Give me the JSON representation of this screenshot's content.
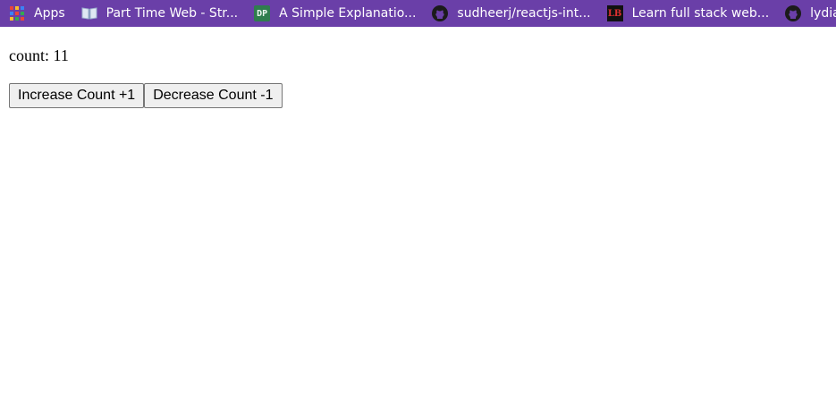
{
  "bookmarks": [
    {
      "label": "Apps",
      "icon": "apps-grid-icon"
    },
    {
      "label": "Part Time Web - Str...",
      "icon": "book-icon"
    },
    {
      "label": "A Simple Explanatio...",
      "icon": "dp-icon",
      "icon_text": "DP"
    },
    {
      "label": "sudheerj/reactjs-int...",
      "icon": "github-icon"
    },
    {
      "label": "Learn full stack web...",
      "icon": "lb-icon",
      "icon_text": "LB"
    },
    {
      "label": "lydiah",
      "icon": "github-icon"
    }
  ],
  "colors": {
    "bookmarks_bar": "#6a3fa8",
    "button_bg": "#efefef",
    "button_border": "#767676"
  },
  "counter": {
    "label": "count:",
    "value": "11"
  },
  "buttons": {
    "increase_label": "Increase Count +1",
    "decrease_label": "Decrease Count -1"
  }
}
